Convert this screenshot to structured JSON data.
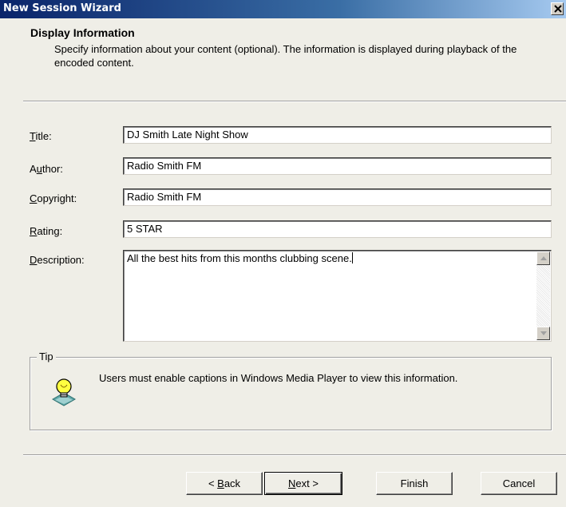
{
  "window": {
    "title": "New Session Wizard",
    "close_glyph": "✕"
  },
  "header": {
    "title": "Display Information",
    "description": "Specify information about your content (optional). The information is displayed during playback of the encoded content."
  },
  "form": {
    "title": {
      "label_accel": "T",
      "label_rest": "itle:",
      "value": "DJ Smith Late Night Show"
    },
    "author": {
      "label_pre": "A",
      "label_accel": "u",
      "label_rest": "thor:",
      "value": "Radio Smith FM"
    },
    "copyright": {
      "label_accel": "C",
      "label_rest": "opyright:",
      "value": "Radio Smith FM"
    },
    "rating": {
      "label_accel": "R",
      "label_rest": "ating:",
      "value": "5 STAR"
    },
    "description": {
      "label_accel": "D",
      "label_rest": "escription:",
      "value": "All the best hits from this months clubbing scene."
    }
  },
  "tip": {
    "legend": "Tip",
    "text": "Users must enable captions in Windows Media Player to view this information.",
    "icon": "lightbulb-icon"
  },
  "buttons": {
    "back_prefix": "< ",
    "back_accel": "B",
    "back_rest": "ack",
    "next_accel": "N",
    "next_rest": "ext >",
    "finish": "Finish",
    "cancel": "Cancel"
  }
}
